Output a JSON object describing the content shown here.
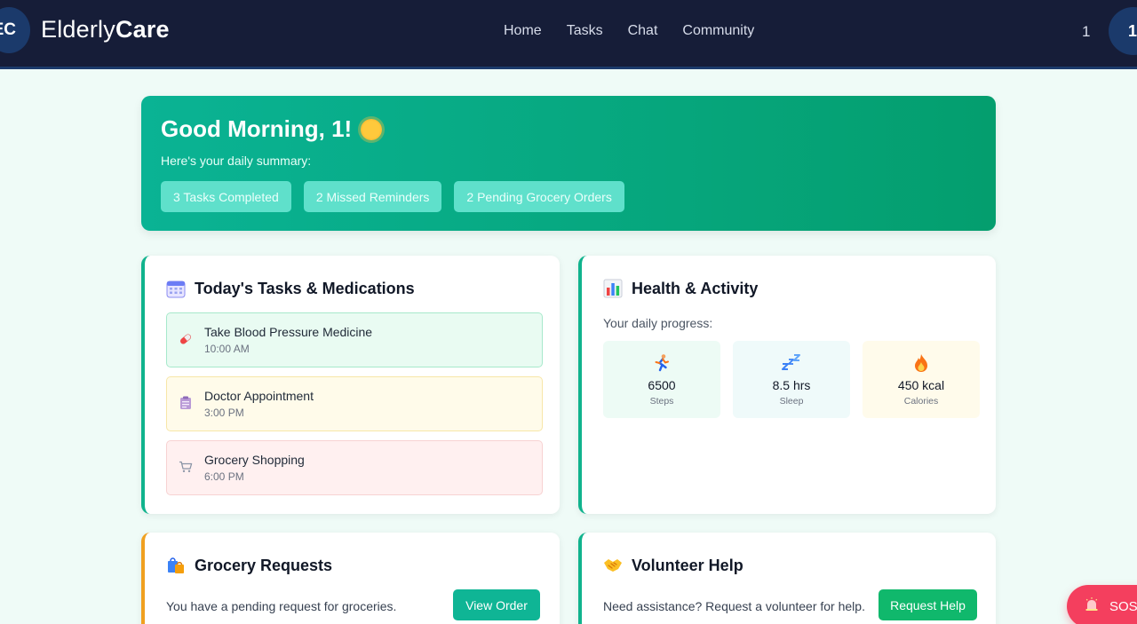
{
  "nav": {
    "logo_initials": "EC",
    "brand_light": "Elderly",
    "brand_bold": "Care",
    "links": [
      "Home",
      "Tasks",
      "Chat",
      "Community"
    ],
    "user_name": "1",
    "avatar_initial": "1"
  },
  "hero": {
    "greeting": "Good Morning, 1!",
    "subtitle": "Here's your daily summary:",
    "pills": [
      "3 Tasks Completed",
      "2 Missed Reminders",
      "2 Pending Grocery Orders"
    ]
  },
  "tasks": {
    "title": "Today's Tasks & Medications",
    "icon": "calendar-icon",
    "items": [
      {
        "name": "Take Blood Pressure Medicine",
        "time": "10:00 AM",
        "icon": "pill-icon"
      },
      {
        "name": "Doctor Appointment",
        "time": "3:00 PM",
        "icon": "clipboard-icon"
      },
      {
        "name": "Grocery Shopping",
        "time": "6:00 PM",
        "icon": "cart-icon"
      }
    ]
  },
  "health": {
    "title": "Health & Activity",
    "icon": "bar-chart-icon",
    "subtitle": "Your daily progress:",
    "stats": [
      {
        "value": "6500",
        "label": "Steps",
        "icon": "running-icon",
        "color": "#edfbf5"
      },
      {
        "value": "8.5 hrs",
        "label": "Sleep",
        "icon": "sleep-icon",
        "color": "#effafa"
      },
      {
        "value": "450 kcal",
        "label": "Calories",
        "icon": "fire-icon",
        "color": "#fffbeb"
      }
    ]
  },
  "grocery": {
    "title": "Grocery Requests",
    "icon": "shopping-bags-icon",
    "text": "You have a pending request for groceries.",
    "button": "View Order"
  },
  "volunteer": {
    "title": "Volunteer Help",
    "icon": "handshake-icon",
    "text": "Need assistance? Request a volunteer for help.",
    "button": "Request Help"
  },
  "sos": {
    "label": "SOS",
    "icon": "siren-icon"
  },
  "colors": {
    "navbar": "#161d38",
    "accent_teal": "#0fb595",
    "accent_green": "#10b86c",
    "sos_red": "#f43f5e",
    "page_bg": "#effbf7"
  }
}
